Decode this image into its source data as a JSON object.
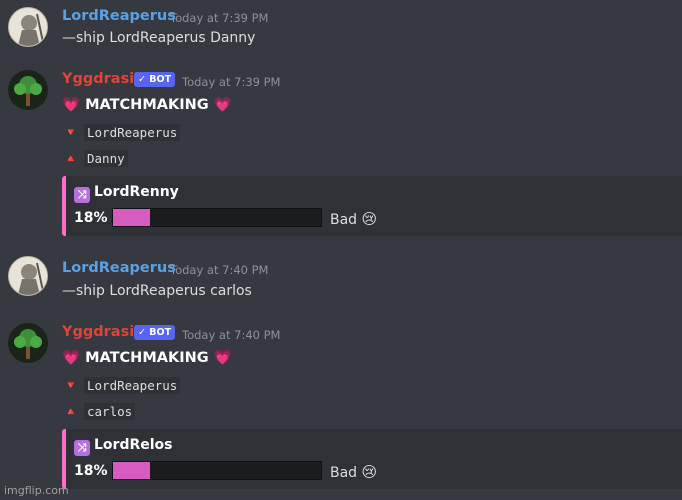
{
  "messages": [
    {
      "author": "LordReaperus",
      "timestamp": "Today at 7:39 PM",
      "text": "—ship LordReaperus Danny"
    },
    {
      "author": "Yggdrasil",
      "bot_badge": "BOT",
      "timestamp": "Today at 7:39 PM",
      "heading": "MATCHMAKING",
      "heart": "💗",
      "down_arrow": "🔻",
      "up_arrow": "🔺",
      "name_down": "LordReaperus",
      "name_up": "Danny",
      "embed": {
        "shuffle_icon": "⤨",
        "ship_name": "LordRenny",
        "percent_text": "18%",
        "percent_value": 18,
        "rating": "Bad",
        "rating_emoji": "😢"
      }
    },
    {
      "author": "LordReaperus",
      "timestamp": "Today at 7:40 PM",
      "text": "—ship LordReaperus carlos"
    },
    {
      "author": "Yggdrasil",
      "bot_badge": "BOT",
      "timestamp": "Today at 7:40 PM",
      "heading": "MATCHMAKING",
      "heart": "💗",
      "down_arrow": "🔻",
      "up_arrow": "🔺",
      "name_down": "LordReaperus",
      "name_up": "carlos",
      "embed": {
        "shuffle_icon": "⤨",
        "ship_name": "LordRelos",
        "percent_text": "18%",
        "percent_value": 18,
        "rating": "Bad",
        "rating_emoji": "😢"
      }
    }
  ],
  "watermark": "imgflip.com",
  "colors": {
    "background": "#36393f",
    "user_name": "#5aa1e6",
    "bot_name": "#e0443b",
    "bot_badge": "#5865f2",
    "embed_accent": "#ff6ec7",
    "bar_fill": "#d65cc1"
  }
}
